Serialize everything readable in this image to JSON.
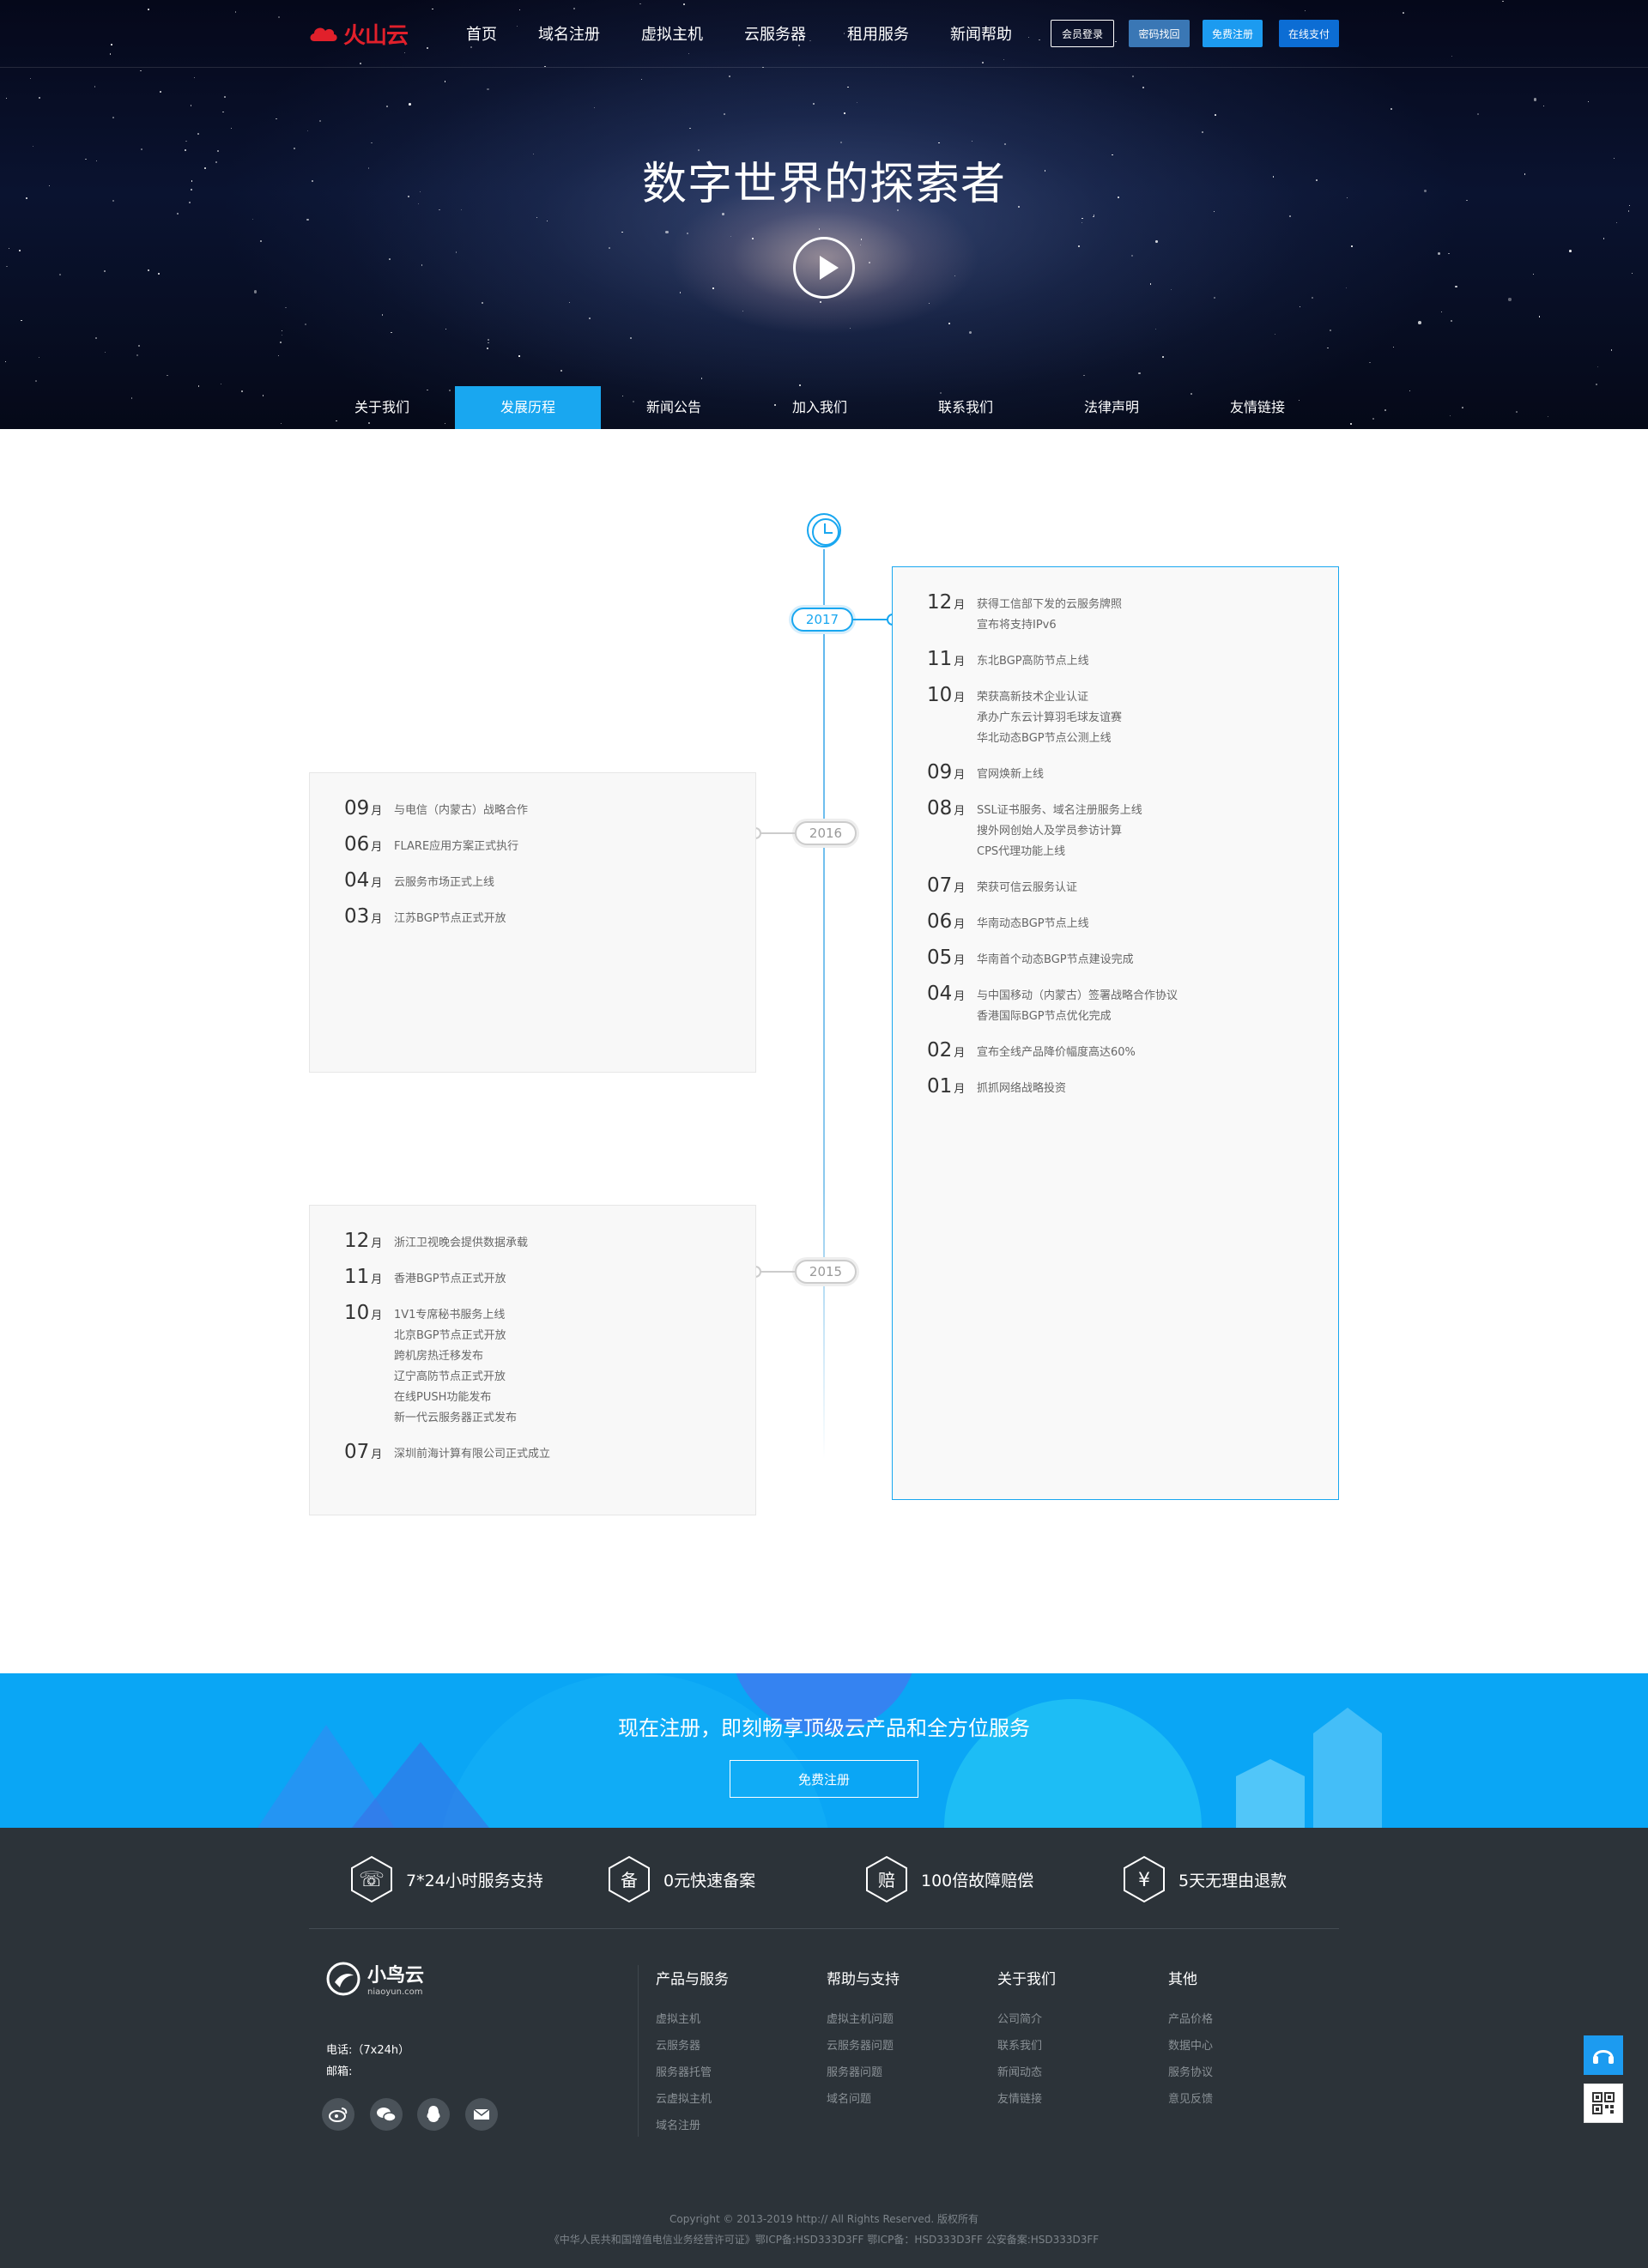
{
  "header": {
    "brand": "火山云",
    "nav": [
      "首页",
      "域名注册",
      "虚拟主机",
      "云服务器",
      "租用服务",
      "新闻帮助"
    ],
    "buttons": {
      "login": "会员登录",
      "pwd": "密码找回",
      "register": "免费注册",
      "pay": "在线支付"
    }
  },
  "hero": {
    "title": "数字世界的探索者"
  },
  "subnav": {
    "items": [
      "关于我们",
      "发展历程",
      "新闻公告",
      "加入我们",
      "联系我们",
      "法律声明",
      "友情链接"
    ],
    "active": "发展历程"
  },
  "timeline": {
    "y2017": {
      "year": "2017",
      "events": [
        {
          "month": "12",
          "unit": "月",
          "text": "获得工信部下发的云服务牌照\n宣布将支持IPv6"
        },
        {
          "month": "11",
          "unit": "月",
          "text": "东北BGP高防节点上线"
        },
        {
          "month": "10",
          "unit": "月",
          "text": "荣获高新技术企业认证\n承办广东云计算羽毛球友谊赛\n华北动态BGP节点公测上线"
        },
        {
          "month": "09",
          "unit": "月",
          "text": "官网焕新上线"
        },
        {
          "month": "08",
          "unit": "月",
          "text": "SSL证书服务、域名注册服务上线\n搜外网创始人及学员参访计算\nCPS代理功能上线"
        },
        {
          "month": "07",
          "unit": "月",
          "text": "荣获可信云服务认证"
        },
        {
          "month": "06",
          "unit": "月",
          "text": "华南动态BGP节点上线"
        },
        {
          "month": "05",
          "unit": "月",
          "text": "华南首个动态BGP节点建设完成"
        },
        {
          "month": "04",
          "unit": "月",
          "text": "与中国移动（内蒙古）签署战略合作协议\n香港国际BGP节点优化完成"
        },
        {
          "month": "02",
          "unit": "月",
          "text": "宣布全线产品降价幅度高达60%"
        },
        {
          "month": "01",
          "unit": "月",
          "text": "抓抓网络战略投资"
        }
      ]
    },
    "y2016": {
      "year": "2016",
      "events": [
        {
          "month": "09",
          "unit": "月",
          "text": "与电信（内蒙古）战略合作"
        },
        {
          "month": "06",
          "unit": "月",
          "text": "FLARE应用方案正式执行"
        },
        {
          "month": "04",
          "unit": "月",
          "text": "云服务市场正式上线"
        },
        {
          "month": "03",
          "unit": "月",
          "text": "江苏BGP节点正式开放"
        }
      ]
    },
    "y2015": {
      "year": "2015",
      "events": [
        {
          "month": "12",
          "unit": "月",
          "text": "浙江卫视晚会提供数据承载"
        },
        {
          "month": "11",
          "unit": "月",
          "text": "香港BGP节点正式开放"
        },
        {
          "month": "10",
          "unit": "月",
          "text": "1V1专席秘书服务上线\n北京BGP节点正式开放\n跨机房热迁移发布\n辽宁高防节点正式开放\n在线PUSH功能发布\n新一代云服务器正式发布"
        },
        {
          "month": "07",
          "unit": "月",
          "text": "深圳前海计算有限公司正式成立"
        }
      ]
    }
  },
  "banner": {
    "title": "现在注册，即刻畅享顶级云产品和全方位服务",
    "button": "免费注册"
  },
  "features": [
    {
      "icon": "phone-icon",
      "glyph": "☏",
      "label": "7*24小时服务支持"
    },
    {
      "icon": "record-icon",
      "glyph": "备",
      "label": "0元快速备案"
    },
    {
      "icon": "compensate-icon",
      "glyph": "赔",
      "label": "100倍故障赔偿"
    },
    {
      "icon": "yen-icon",
      "glyph": "¥",
      "label": "5天无理由退款"
    }
  ],
  "footer": {
    "brand": "小鸟云",
    "domain": "niaoyun.com",
    "phone": "电话:（7x24h）",
    "email": "邮箱:",
    "columns": [
      {
        "title": "产品与服务",
        "items": [
          "虚拟主机",
          "云服务器",
          "服务器托管",
          "云虚拟主机",
          "域名注册"
        ]
      },
      {
        "title": "帮助与支持",
        "items": [
          "虚拟主机问题",
          "云服务器问题",
          "服务器问题",
          "域名问题"
        ]
      },
      {
        "title": "关于我们",
        "items": [
          "公司简介",
          "联系我们",
          "新闻动态",
          "友情链接"
        ]
      },
      {
        "title": "其他",
        "items": [
          "产品价格",
          "数据中心",
          "服务协议",
          "意见反馈"
        ]
      }
    ],
    "copyright": "Copyright © 2013-2019    http://    All Rights Reserved. 版权所有",
    "icp": "《中华人民共和国增值电信业务经营许可证》鄂ICP备:HSD333D3FF     鄂ICP备：HSD333D3FF 公安备案:HSD333D3FF"
  },
  "colors": {
    "accent": "#19a7f0",
    "brand_red": "#e1202b",
    "footer_bg": "#2c3339",
    "banner_bg": "#0aa6f5"
  }
}
